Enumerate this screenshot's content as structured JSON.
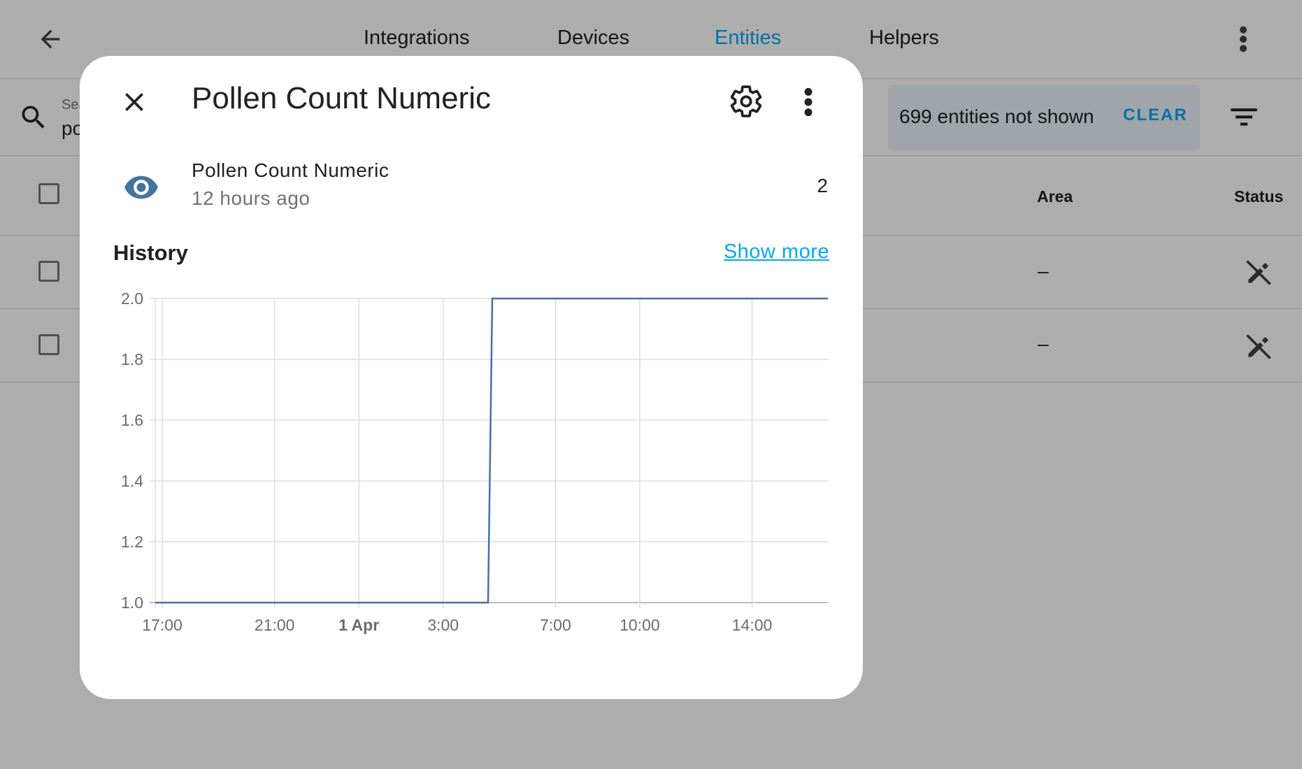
{
  "background": {
    "tabs": [
      {
        "label": "Integrations",
        "active": false
      },
      {
        "label": "Devices",
        "active": false
      },
      {
        "label": "Entities",
        "active": true
      },
      {
        "label": "Helpers",
        "active": false
      }
    ],
    "search": {
      "label": "Sea",
      "value": "po"
    },
    "filter_notice": {
      "text": "699 entities not shown",
      "clear_label": "CLEAR"
    },
    "columns": {
      "area": "Area",
      "status": "Status"
    },
    "rows": [
      {
        "area": "–"
      },
      {
        "area": "–"
      }
    ]
  },
  "dialog": {
    "title": "Pollen Count Numeric",
    "entity_name": "Pollen Count Numeric",
    "last_changed": "12 hours ago",
    "state": "2",
    "history_label": "History",
    "show_more_label": "Show more"
  },
  "colors": {
    "accent": "#03a9f4",
    "line": "#4a6f9c",
    "eye_icon": "#44739e"
  },
  "chart_data": {
    "type": "line",
    "title": "",
    "xlabel": "",
    "ylabel": "",
    "ylim": [
      1.0,
      2.0
    ],
    "y_ticks": [
      "2.0",
      "1.8",
      "1.6",
      "1.4",
      "1.2",
      "1.0"
    ],
    "x_ticks": [
      {
        "label": "17:00",
        "hour": 0,
        "bold": false
      },
      {
        "label": "21:00",
        "hour": 4,
        "bold": false
      },
      {
        "label": "1 Apr",
        "hour": 7,
        "bold": true
      },
      {
        "label": "3:00",
        "hour": 10,
        "bold": false
      },
      {
        "label": "7:00",
        "hour": 14,
        "bold": false
      },
      {
        "label": "10:00",
        "hour": 17,
        "bold": false
      },
      {
        "label": "14:00",
        "hour": 21,
        "bold": false
      }
    ],
    "x_range": [
      -0.25,
      23.7
    ],
    "grid": true,
    "series": [
      {
        "name": "",
        "step": true,
        "points": [
          {
            "x": -0.25,
            "y": 1.0
          },
          {
            "x": 11.6,
            "y": 1.0
          },
          {
            "x": 11.75,
            "y": 2.0
          },
          {
            "x": 23.7,
            "y": 2.0
          }
        ]
      }
    ]
  }
}
